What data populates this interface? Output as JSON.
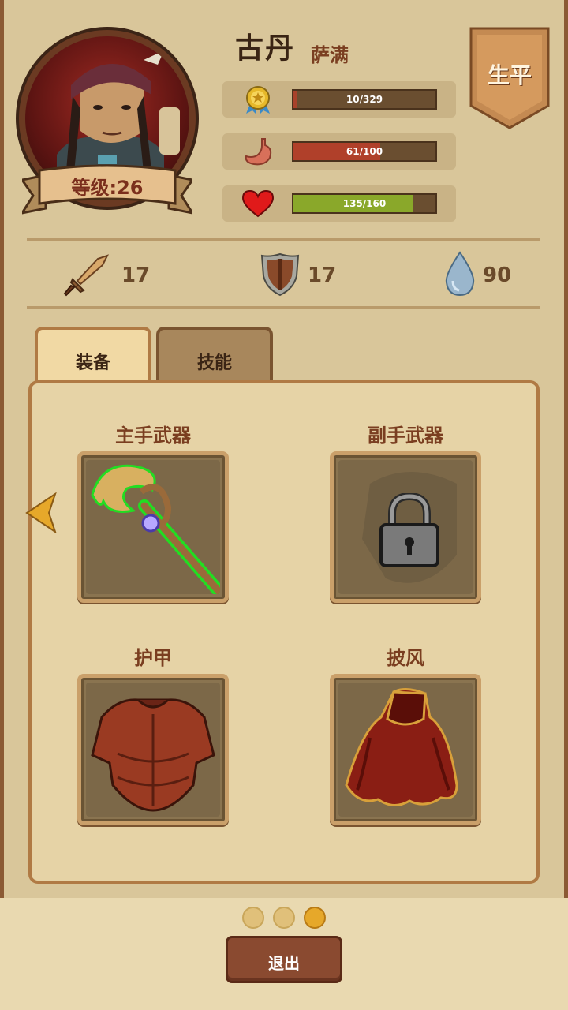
{
  "character": {
    "name": "古丹",
    "class": "萨满",
    "level_label": "等级:26"
  },
  "stats": {
    "experience": {
      "text": "10/329",
      "current": 10,
      "max": 329,
      "color": "#a8422a",
      "icon": "medal-icon"
    },
    "hunger": {
      "text": "61/100",
      "current": 61,
      "max": 100,
      "color": "#b0402a",
      "icon": "stomach-icon"
    },
    "health": {
      "text": "135/160",
      "current": 135,
      "max": 160,
      "color": "#8aa82a",
      "icon": "heart-icon"
    }
  },
  "bio_button": {
    "label": "生平"
  },
  "attributes": {
    "attack": {
      "value": "17",
      "icon": "sword-icon"
    },
    "defense": {
      "value": "17",
      "icon": "shield-icon"
    },
    "water": {
      "value": "90",
      "icon": "water-drop-icon"
    }
  },
  "tabs": [
    {
      "label": "装备",
      "active": true
    },
    {
      "label": "技能",
      "active": false
    }
  ],
  "slots": {
    "main_hand": {
      "label": "主手武器",
      "item": "staff-icon"
    },
    "off_hand": {
      "label": "副手武器",
      "item": "lock-icon",
      "locked": true
    },
    "armor": {
      "label": "护甲",
      "item": "armor-icon"
    },
    "cloak": {
      "label": "披风",
      "item": "cloak-icon"
    }
  },
  "pagination": {
    "pages": 3,
    "current": 3
  },
  "exit_button": {
    "label": "退出"
  }
}
